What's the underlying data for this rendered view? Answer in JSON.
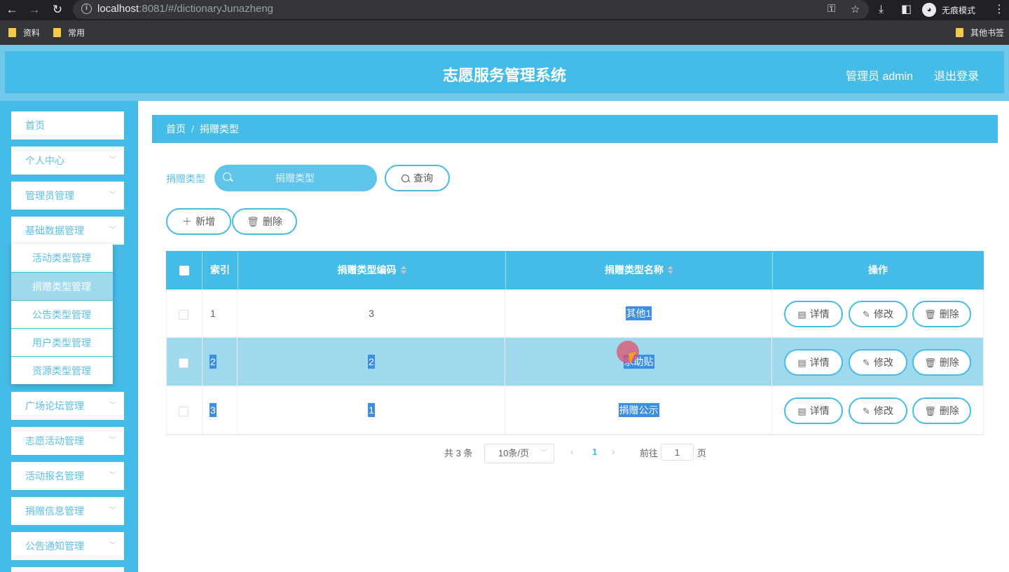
{
  "browser": {
    "url_host": "localhost",
    "url_rest": ":8081/#/dictionaryJunazheng",
    "incognito_label": "无痕模式",
    "bookmarks": [
      "资料",
      "常用"
    ],
    "other_bookmarks": "其他书签"
  },
  "header": {
    "title": "志愿服务管理系统",
    "admin_label": "管理员 admin",
    "logout_label": "退出登录"
  },
  "sidebar": {
    "items": [
      {
        "label": "首页"
      },
      {
        "label": "个人中心"
      },
      {
        "label": "管理员管理"
      },
      {
        "label": "基础数据管理"
      },
      {
        "label": "广场论坛管理"
      },
      {
        "label": "志愿活动管理"
      },
      {
        "label": "活动报名管理"
      },
      {
        "label": "捐赠信息管理"
      },
      {
        "label": "公告通知管理"
      }
    ],
    "submenu": [
      {
        "label": "活动类型管理"
      },
      {
        "label": "捐赠类型管理"
      },
      {
        "label": "公告类型管理"
      },
      {
        "label": "用户类型管理"
      },
      {
        "label": "资源类型管理"
      }
    ]
  },
  "breadcrumb": {
    "home": "首页",
    "separator": "/",
    "current": "捐赠类型"
  },
  "search": {
    "label": "捐赠类型",
    "placeholder": "捐赠类型",
    "query_button": "查询"
  },
  "actions": {
    "add_button": "新增",
    "delete_button": "删除"
  },
  "table": {
    "headers": {
      "index": "索引",
      "code": "捐赠类型编码",
      "name": "捐赠类型名称",
      "ops": "操作"
    },
    "rows": [
      {
        "index": "1",
        "code": "3",
        "name": "其他1"
      },
      {
        "index": "2",
        "code": "2",
        "name": "求助贴"
      },
      {
        "index": "3",
        "code": "1",
        "name": "捐赠公示"
      }
    ],
    "op_labels": {
      "detail": "详情",
      "edit": "修改",
      "delete": "删除"
    }
  },
  "pagination": {
    "total": "共 3 条",
    "page_size": "10条/页",
    "current_page": "1",
    "goto_label": "前往",
    "goto_value": "1",
    "page_suffix": "页"
  },
  "colors": {
    "primary": "#45bbe7",
    "row_highlight": "#9fd9ee",
    "selection": "#3a8ee6"
  }
}
